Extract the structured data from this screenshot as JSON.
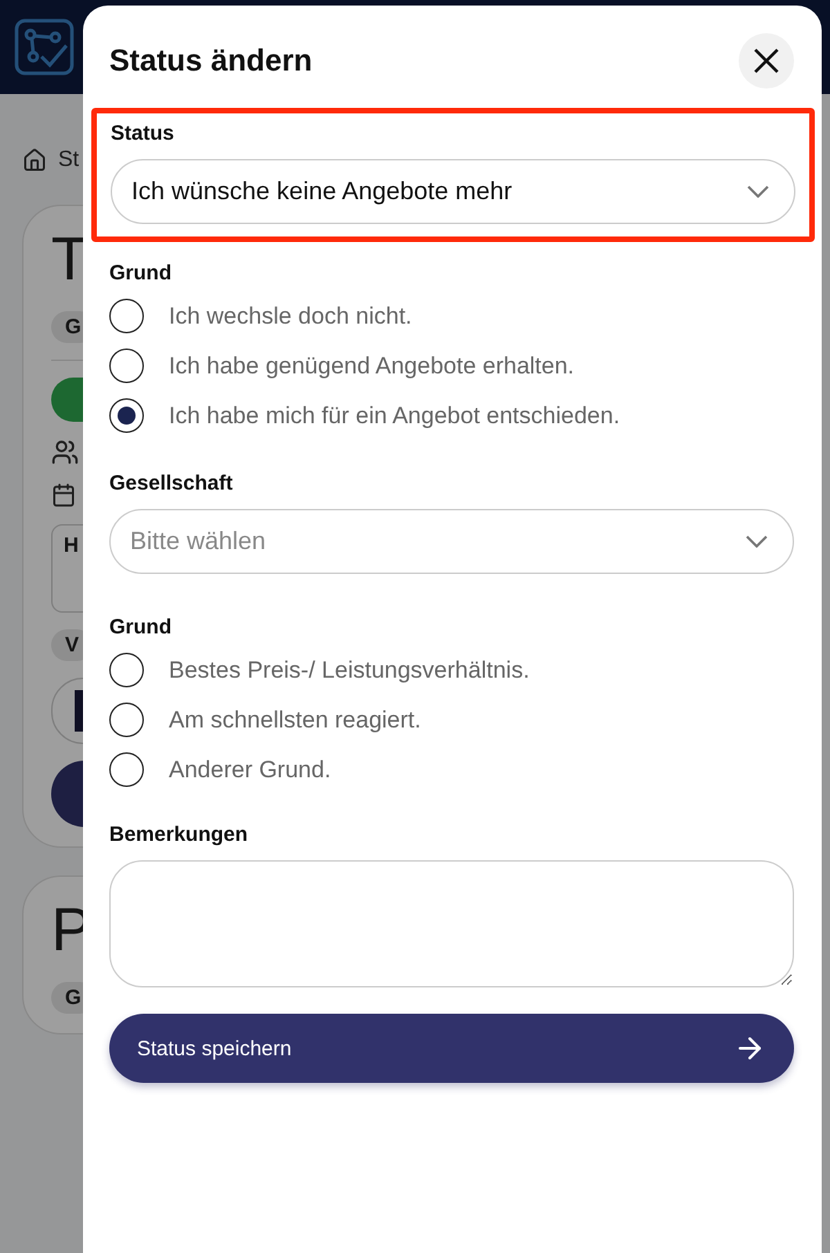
{
  "background": {
    "breadcrumb": "St",
    "cards": [
      {
        "title": "T",
        "badge": "G",
        "box_label": "H",
        "badge_2": "V"
      },
      {
        "title": "P",
        "badge": "G"
      }
    ]
  },
  "dialog": {
    "title": "Status ändern",
    "status": {
      "label": "Status",
      "value": "Ich wünsche keine Angebote mehr",
      "highlighted": true
    },
    "reason_1": {
      "label": "Grund",
      "options": [
        {
          "label": "Ich wechsle doch nicht.",
          "selected": false
        },
        {
          "label": "Ich habe genügend Angebote erhalten.",
          "selected": false
        },
        {
          "label": "Ich habe mich für ein Angebot entschieden.",
          "selected": true
        }
      ]
    },
    "company": {
      "label": "Gesellschaft",
      "placeholder": "Bitte wählen"
    },
    "reason_2": {
      "label": "Grund",
      "options": [
        {
          "label": "Bestes Preis-/ Leistungsverhältnis.",
          "selected": false
        },
        {
          "label": "Am schnellsten reagiert.",
          "selected": false
        },
        {
          "label": "Anderer Grund.",
          "selected": false
        }
      ]
    },
    "remarks": {
      "label": "Bemerkungen"
    },
    "save_button": "Status speichern"
  }
}
